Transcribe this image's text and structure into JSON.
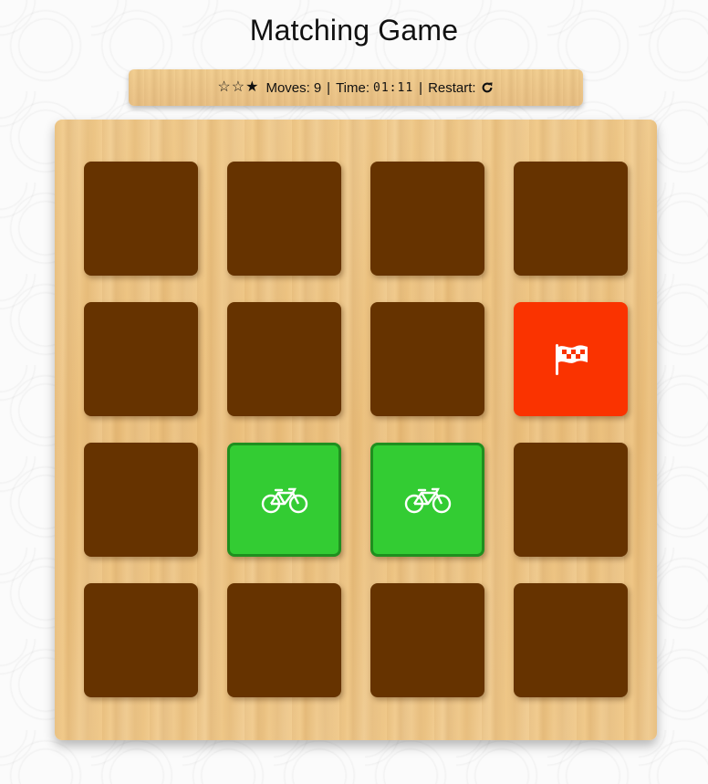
{
  "title": "Matching Game",
  "score_panel": {
    "stars": [
      "empty",
      "empty",
      "filled"
    ],
    "moves_label": "Moves:",
    "moves": "9",
    "separator": "|",
    "time_label": "Time:",
    "time": "01:11",
    "restart_label": "Restart:",
    "restart_icon": "repeat-icon"
  },
  "deck": {
    "rows": 4,
    "cols": 4,
    "cards": [
      {
        "state": "closed",
        "icon": ""
      },
      {
        "state": "closed",
        "icon": ""
      },
      {
        "state": "closed",
        "icon": ""
      },
      {
        "state": "closed",
        "icon": ""
      },
      {
        "state": "closed",
        "icon": ""
      },
      {
        "state": "closed",
        "icon": ""
      },
      {
        "state": "closed",
        "icon": ""
      },
      {
        "state": "open",
        "icon": "flag-checkered-icon"
      },
      {
        "state": "closed",
        "icon": ""
      },
      {
        "state": "match",
        "icon": "bicycle-icon"
      },
      {
        "state": "match",
        "icon": "bicycle-icon"
      },
      {
        "state": "closed",
        "icon": ""
      },
      {
        "state": "closed",
        "icon": ""
      },
      {
        "state": "closed",
        "icon": ""
      },
      {
        "state": "closed",
        "icon": ""
      },
      {
        "state": "closed",
        "icon": ""
      }
    ]
  },
  "colors": {
    "card_back": "#663300",
    "card_open": "#fa3300",
    "card_match": "#33cc33"
  }
}
